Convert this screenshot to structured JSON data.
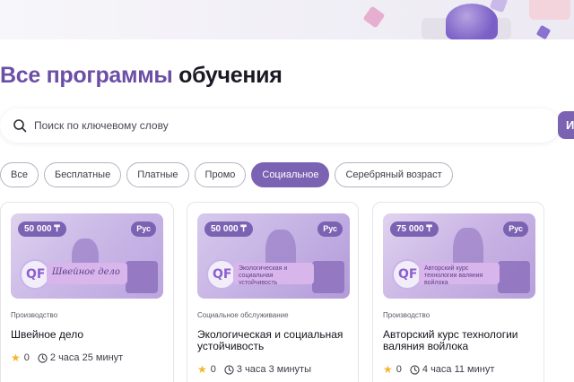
{
  "page": {
    "title_accent": "Все программы",
    "title_rest": "обучения"
  },
  "search": {
    "placeholder": "Поиск по ключевому слову",
    "value": "",
    "button_label": "И"
  },
  "filters": [
    {
      "label": "Все",
      "active": false
    },
    {
      "label": "Бесплатные",
      "active": false
    },
    {
      "label": "Платные",
      "active": false
    },
    {
      "label": "Промо",
      "active": false
    },
    {
      "label": "Социальное",
      "active": true
    },
    {
      "label": "Серебряный возраст",
      "active": false
    }
  ],
  "cards": [
    {
      "price": "50 000 ₸",
      "language": "Рус",
      "thumb_caption": "Швейное дело",
      "category": "Производство",
      "title": "Швейное дело",
      "rating": "0",
      "duration": "2 часа 25 минут"
    },
    {
      "price": "50 000 ₸",
      "language": "Рус",
      "thumb_caption": "Экологическая и социальная устойчивость",
      "category": "Социальное обслуживание",
      "title": "Экологическая и социальная устойчивость",
      "rating": "0",
      "duration": "3 часа 3 минуты"
    },
    {
      "price": "75 000 ₸",
      "language": "Рус",
      "thumb_caption": "Авторский курс технологии валяния войлока",
      "category": "Производство",
      "title": "Авторский курс технологии валяния войлока",
      "rating": "0",
      "duration": "4 часа 11 минут"
    }
  ],
  "icons": {
    "search": "search-icon",
    "star": "star-icon",
    "clock": "clock-icon"
  },
  "colors": {
    "accent": "#7c62b2",
    "title_accent": "#6b4fa6",
    "star": "#f2b82a"
  }
}
